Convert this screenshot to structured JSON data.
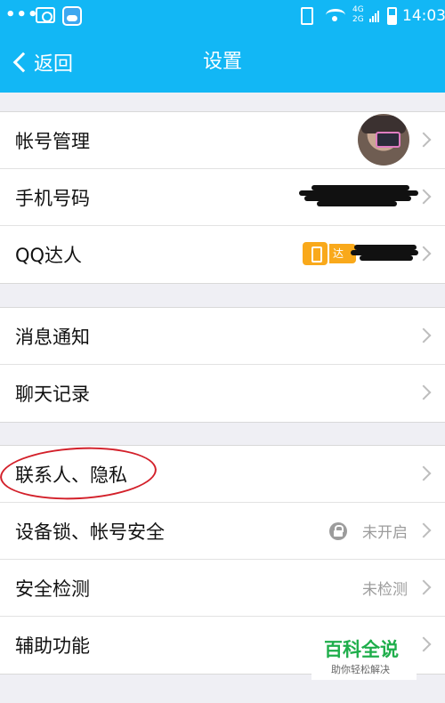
{
  "status_bar": {
    "dots": "•••",
    "network": "4G\n2G",
    "time": "14:03"
  },
  "header": {
    "back_label": "返回",
    "title": "设置"
  },
  "groups": [
    {
      "rows": [
        {
          "label": "帐号管理"
        },
        {
          "label": "手机号码"
        },
        {
          "label": "QQ达人",
          "badge": "达人"
        }
      ]
    },
    {
      "rows": [
        {
          "label": "消息通知"
        },
        {
          "label": "聊天记录"
        }
      ]
    },
    {
      "rows": [
        {
          "label": "联系人、隐私"
        },
        {
          "label": "设备锁、帐号安全",
          "value": "未开启"
        },
        {
          "label": "安全检测",
          "value": "未检测"
        },
        {
          "label": "辅助功能"
        }
      ]
    }
  ],
  "watermark": {
    "title": "百科全说",
    "subtitle": "助你轻松解决"
  },
  "colors": {
    "accent": "#12b7f5",
    "annotation": "#d3202a",
    "watermark": "#1fae4b"
  }
}
